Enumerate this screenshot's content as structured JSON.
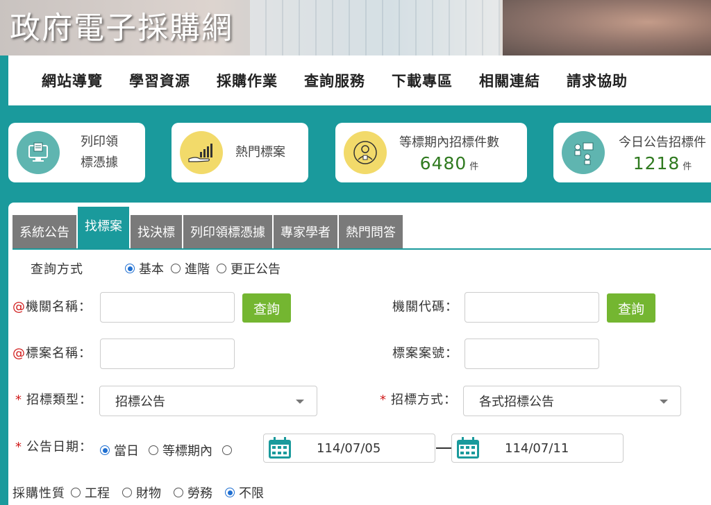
{
  "site": {
    "title": "政府電子採購網"
  },
  "nav": {
    "items": [
      "網站導覽",
      "學習資源",
      "採購作業",
      "查詢服務",
      "下載專區",
      "相關連結",
      "請求協助"
    ]
  },
  "cards": {
    "print": {
      "line1": "列印領",
      "line2": "標憑據",
      "icon": "print-monitor-icon"
    },
    "hot": {
      "label": "熱門標案",
      "icon": "chart-hand-icon"
    },
    "pending": {
      "label": "等標期內招標件數",
      "count": "6480",
      "unit": "件",
      "icon": "person-badge-icon"
    },
    "today": {
      "label": "今日公告招標件",
      "count": "1218",
      "unit": "件",
      "icon": "people-chat-icon"
    }
  },
  "tabs": [
    "系統公告",
    "找標案",
    "找決標",
    "列印領標憑據",
    "專家學者",
    "熱門問答"
  ],
  "form": {
    "query_mode": {
      "label": "查詢方式",
      "options": [
        "基本",
        "進階",
        "更正公告"
      ],
      "selected": "基本"
    },
    "org_name": {
      "label": "機關名稱：",
      "prefix": "@",
      "value": ""
    },
    "org_code": {
      "label": "機關代碼：",
      "value": ""
    },
    "search_button": "查詢",
    "tender_name": {
      "label": "標案名稱：",
      "prefix": "@",
      "value": ""
    },
    "tender_no": {
      "label": "標案案號：",
      "value": ""
    },
    "tender_type": {
      "label": "招標類型：",
      "required": "*",
      "value": "招標公告"
    },
    "tender_method": {
      "label": "招標方式：",
      "required": "*",
      "value": "各式招標公告"
    },
    "date": {
      "label": "公告日期：",
      "required": "*",
      "options": [
        "當日",
        "等標期內"
      ],
      "selected": "當日",
      "from": "114/07/05",
      "to": "114/07/11"
    },
    "nature": {
      "label": "採購性質",
      "options": [
        "工程",
        "財物",
        "勞務",
        "不限"
      ],
      "selected": "不限"
    }
  },
  "colors": {
    "teal": "#1a9a9c",
    "green_button": "#74b631",
    "tab_gray": "#7a7a7a",
    "count_green": "#2f7a1f",
    "required_red": "#d01a1a"
  }
}
